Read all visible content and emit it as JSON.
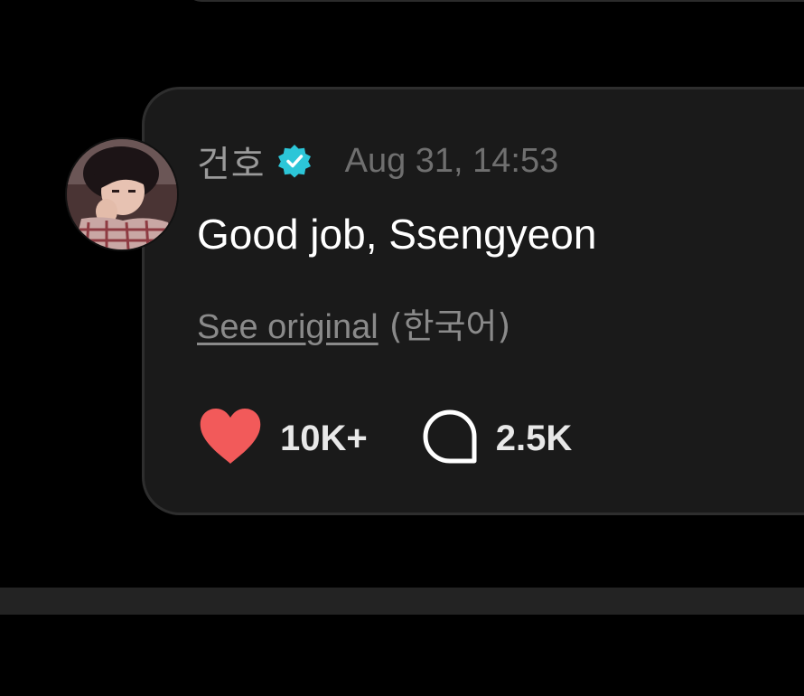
{
  "comment": {
    "author": "건호",
    "verified_icon": "verified-badge-icon",
    "timestamp": "Aug 31, 14:53",
    "text": "Good job, Ssengyeon",
    "see_original_label": "See original",
    "original_language": "(한국어)",
    "likes_count": "10K+",
    "replies_count": "2.5K"
  },
  "colors": {
    "background": "#000000",
    "card": "#1a1a1a",
    "heart": "#f25a5a",
    "verified": "#2cc6d8",
    "text_primary": "#ffffff",
    "text_muted": "#8a8a8a"
  },
  "icons": {
    "like": "heart-icon",
    "reply": "speech-bubble-icon"
  }
}
